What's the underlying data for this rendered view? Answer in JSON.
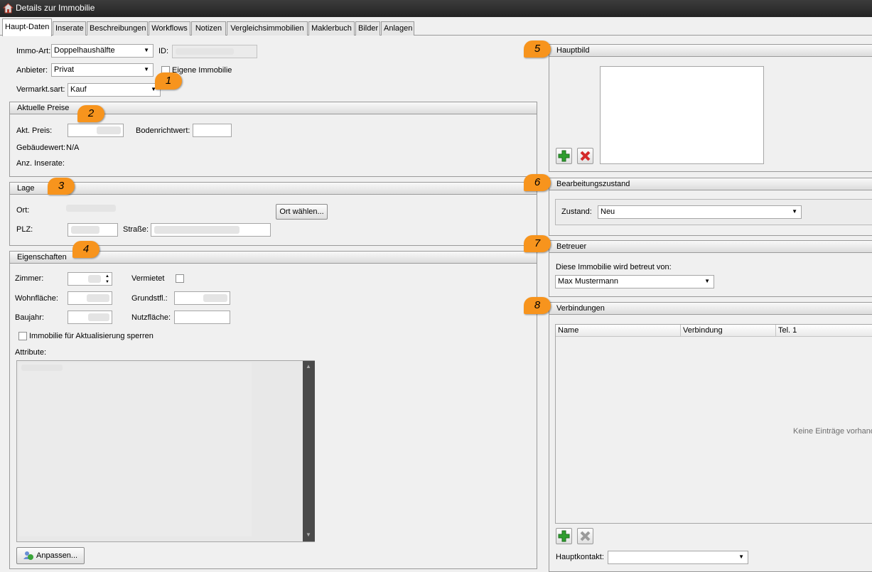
{
  "window": {
    "title": "Details zur Immobilie"
  },
  "tabs": [
    {
      "label": "Haupt-Daten",
      "active": true
    },
    {
      "label": "Inserate"
    },
    {
      "label": "Beschreibungen"
    },
    {
      "label": "Workflows"
    },
    {
      "label": "Notizen"
    },
    {
      "label": "Vergleichsimmobilien"
    },
    {
      "label": "Maklerbuch"
    },
    {
      "label": "Bilder"
    },
    {
      "label": "Anlagen"
    }
  ],
  "basics": {
    "immo_art_label": "Immo-Art:",
    "immo_art_value": "Doppelhaushälfte",
    "id_label": "ID:",
    "anbieter_label": "Anbieter:",
    "anbieter_value": "Privat",
    "eigene_label": "Eigene Immobilie",
    "vermarkt_label": "Vermarkt.sart:",
    "vermarkt_value": "Kauf"
  },
  "preise": {
    "header": "Aktuelle Preise",
    "akt_preis_label": "Akt. Preis:",
    "bodenrichtwert_label": "Bodenrichtwert:",
    "gebaeudewert_label": "Gebäudewert:",
    "gebaeudewert_value": "N/A",
    "anz_inserate_label": "Anz. Inserate:"
  },
  "lage": {
    "header": "Lage",
    "ort_label": "Ort:",
    "ort_button": "Ort wählen...",
    "plz_label": "PLZ:",
    "strasse_label": "Straße:"
  },
  "eigenschaften": {
    "header": "Eigenschaften",
    "zimmer_label": "Zimmer:",
    "vermietet_label": "Vermietet",
    "wohnflaeche_label": "Wohnfläche:",
    "grundstfl_label": "Grundstfl.:",
    "baujahr_label": "Baujahr:",
    "nutzflaeche_label": "Nutzfläche:",
    "sperren_label": "Immobilie für Aktualisierung sperren",
    "attribute_label": "Attribute:",
    "anpassen_button": "Anpassen..."
  },
  "hauptbild": {
    "header": "Hauptbild"
  },
  "bearbeitungszustand": {
    "header": "Bearbeitungszustand",
    "zustand_label": "Zustand:",
    "zustand_value": "Neu"
  },
  "betreuer": {
    "header": "Betreuer",
    "info": "Diese Immobilie wird betreut von:",
    "value": "Max Mustermann"
  },
  "verbindungen": {
    "header": "Verbindungen",
    "columns": [
      "Name",
      "Verbindung",
      "Tel. 1"
    ],
    "empty_text": "Keine Einträge vorhand",
    "hauptkontakt_label": "Hauptkontakt:"
  },
  "markers": [
    "1",
    "2",
    "3",
    "4",
    "5",
    "6",
    "7",
    "8"
  ],
  "colors": {
    "marker": "#f7941d",
    "titlebar": "#2b2b2b",
    "add_green": "#2e9e2e",
    "delete_red": "#d42a2a"
  }
}
